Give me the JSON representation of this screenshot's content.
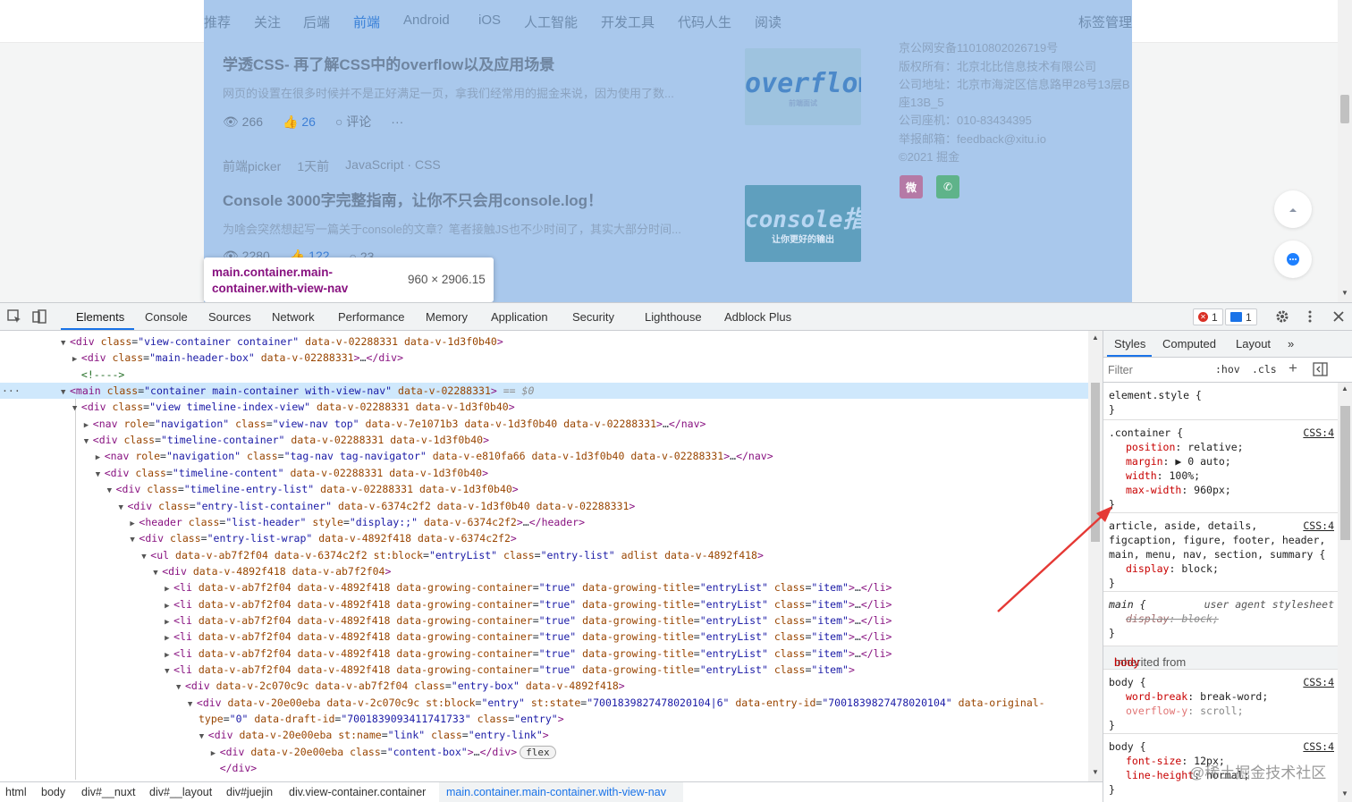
{
  "page": {
    "nav_items": [
      "推荐",
      "关注",
      "后端",
      "前端",
      "Android",
      "iOS",
      "人工智能",
      "开发工具",
      "代码人生",
      "阅读"
    ],
    "nav_active": "前端",
    "nav_right": "标签管理",
    "articles": [
      {
        "title": "学透CSS- 再了解CSS中的overflow以及应用场景",
        "desc": "网页的设置在很多时候并不是正好满足一页，拿我们经常用的掘金来说，因为使用了数...",
        "views": "266",
        "likes": "26",
        "comments": "评论",
        "more": "···",
        "thumb_big": "overflow",
        "thumb_small": "前端面试"
      },
      {
        "author": "前端picker",
        "time": "1天前",
        "tags": "JavaScript · CSS",
        "title": "Console 3000字完整指南，让你不只会用console.log！",
        "desc": "为啥会突然想起写一篇关于console的文章？笔者接触JS也不少时间了，其实大部分时间...",
        "views": "2280",
        "likes": "122",
        "comments": "23",
        "thumb_big": "console指南",
        "thumb_small": "让你更好的输出"
      }
    ],
    "footer": [
      "京公网安备11010802026719号",
      "版权所有：北京北比信息技术有限公司",
      "公司地址：北京市海淀区信息路甲28号13层B",
      "座13B_5",
      "公司座机：010-83434395",
      "举报邮箱：feedback@xitu.io",
      "©2021 掘金"
    ],
    "social": {
      "weibo": "微",
      "wechat": "✆"
    },
    "tooltip": {
      "selector": "main.container.main-container.with-view-nav",
      "size": "960 × 2906.15"
    }
  },
  "devtools": {
    "tabs": [
      "Elements",
      "Console",
      "Sources",
      "Network",
      "Performance",
      "Memory",
      "Application",
      "Security",
      "Lighthouse",
      "Adblock Plus"
    ],
    "active_tab": "Elements",
    "error_count": "1",
    "info_count": "1",
    "dom_lines": [
      {
        "indent": 0,
        "tri": "▼",
        "html": "<span class='tag'>&lt;div</span> <span class='an'>class</span>=<span class='av'>\"view-container container\"</span> <span class='an'>data-v-02288331</span> <span class='an'>data-v-1d3f0b40</span><span class='tag'>&gt;</span>"
      },
      {
        "indent": 1,
        "tri": "▶",
        "html": "<span class='tag'>&lt;div</span> <span class='an'>class</span>=<span class='av'>\"main-header-box\"</span> <span class='an'>data-v-02288331</span><span class='tag'>&gt;</span>…<span class='tag'>&lt;/div&gt;</span>"
      },
      {
        "indent": 1,
        "tri": "",
        "html": "<span class='cm'>&lt;!----&gt;</span>"
      },
      {
        "indent": 0,
        "tri": "▼",
        "selected": true,
        "html": "<span class='tag'>&lt;main</span> <span class='an'>class</span>=<span class='av'>\"container main-container with-view-nav\"</span> <span class='an'>data-v-02288331</span><span class='tag'>&gt;</span> <span class='eq'>== $0</span>"
      },
      {
        "indent": 1,
        "tri": "▼",
        "html": "<span class='tag'>&lt;div</span> <span class='an'>class</span>=<span class='av'>\"view timeline-index-view\"</span> <span class='an'>data-v-02288331</span> <span class='an'>data-v-1d3f0b40</span><span class='tag'>&gt;</span>"
      },
      {
        "indent": 2,
        "tri": "▶",
        "html": "<span class='tag'>&lt;nav</span> <span class='an'>role</span>=<span class='av'>\"navigation\"</span> <span class='an'>class</span>=<span class='av'>\"view-nav top\"</span> <span class='an'>data-v-7e1071b3</span> <span class='an'>data-v-1d3f0b40</span> <span class='an'>data-v-02288331</span><span class='tag'>&gt;</span>…<span class='tag'>&lt;/nav&gt;</span>"
      },
      {
        "indent": 2,
        "tri": "▼",
        "html": "<span class='tag'>&lt;div</span> <span class='an'>class</span>=<span class='av'>\"timeline-container\"</span> <span class='an'>data-v-02288331</span> <span class='an'>data-v-1d3f0b40</span><span class='tag'>&gt;</span>"
      },
      {
        "indent": 3,
        "tri": "▶",
        "html": "<span class='tag'>&lt;nav</span> <span class='an'>role</span>=<span class='av'>\"navigation\"</span> <span class='an'>class</span>=<span class='av'>\"tag-nav tag-navigator\"</span> <span class='an'>data-v-e810fa66</span> <span class='an'>data-v-1d3f0b40</span> <span class='an'>data-v-02288331</span><span class='tag'>&gt;</span>…<span class='tag'>&lt;/nav&gt;</span>"
      },
      {
        "indent": 3,
        "tri": "▼",
        "html": "<span class='tag'>&lt;div</span> <span class='an'>class</span>=<span class='av'>\"timeline-content\"</span> <span class='an'>data-v-02288331</span> <span class='an'>data-v-1d3f0b40</span><span class='tag'>&gt;</span>"
      },
      {
        "indent": 4,
        "tri": "▼",
        "html": "<span class='tag'>&lt;div</span> <span class='an'>class</span>=<span class='av'>\"timeline-entry-list\"</span> <span class='an'>data-v-02288331</span> <span class='an'>data-v-1d3f0b40</span><span class='tag'>&gt;</span>"
      },
      {
        "indent": 5,
        "tri": "▼",
        "html": "<span class='tag'>&lt;div</span> <span class='an'>class</span>=<span class='av'>\"entry-list-container\"</span> <span class='an'>data-v-6374c2f2</span> <span class='an'>data-v-1d3f0b40</span> <span class='an'>data-v-02288331</span><span class='tag'>&gt;</span>"
      },
      {
        "indent": 6,
        "tri": "▶",
        "html": "<span class='tag'>&lt;header</span> <span class='an'>class</span>=<span class='av'>\"list-header\"</span> <span class='an'>style</span>=<span class='av'>\"display:;\"</span> <span class='an'>data-v-6374c2f2</span><span class='tag'>&gt;</span>…<span class='tag'>&lt;/header&gt;</span>"
      },
      {
        "indent": 6,
        "tri": "▼",
        "html": "<span class='tag'>&lt;div</span> <span class='an'>class</span>=<span class='av'>\"entry-list-wrap\"</span> <span class='an'>data-v-4892f418</span> <span class='an'>data-v-6374c2f2</span><span class='tag'>&gt;</span>"
      },
      {
        "indent": 7,
        "tri": "▼",
        "html": "<span class='tag'>&lt;ul</span> <span class='an'>data-v-ab7f2f04</span> <span class='an'>data-v-6374c2f2</span> <span class='an'>st:block</span>=<span class='av'>\"entryList\"</span> <span class='an'>class</span>=<span class='av'>\"entry-list\"</span> <span class='an'>adlist</span> <span class='an'>data-v-4892f418</span><span class='tag'>&gt;</span>"
      },
      {
        "indent": 8,
        "tri": "▼",
        "html": "<span class='tag'>&lt;div</span> <span class='an'>data-v-4892f418</span> <span class='an'>data-v-ab7f2f04</span><span class='tag'>&gt;</span>"
      },
      {
        "indent": 9,
        "tri": "▶",
        "html": "<span class='tag'>&lt;li</span> <span class='an'>data-v-ab7f2f04</span> <span class='an'>data-v-4892f418</span> <span class='an'>data-growing-container</span>=<span class='av'>\"true\"</span> <span class='an'>data-growing-title</span>=<span class='av'>\"entryList\"</span> <span class='an'>class</span>=<span class='av'>\"item\"</span><span class='tag'>&gt;</span>…<span class='tag'>&lt;/li&gt;</span>"
      },
      {
        "indent": 9,
        "tri": "▶",
        "html": "<span class='tag'>&lt;li</span> <span class='an'>data-v-ab7f2f04</span> <span class='an'>data-v-4892f418</span> <span class='an'>data-growing-container</span>=<span class='av'>\"true\"</span> <span class='an'>data-growing-title</span>=<span class='av'>\"entryList\"</span> <span class='an'>class</span>=<span class='av'>\"item\"</span><span class='tag'>&gt;</span>…<span class='tag'>&lt;/li&gt;</span>"
      },
      {
        "indent": 9,
        "tri": "▶",
        "html": "<span class='tag'>&lt;li</span> <span class='an'>data-v-ab7f2f04</span> <span class='an'>data-v-4892f418</span> <span class='an'>data-growing-container</span>=<span class='av'>\"true\"</span> <span class='an'>data-growing-title</span>=<span class='av'>\"entryList\"</span> <span class='an'>class</span>=<span class='av'>\"item\"</span><span class='tag'>&gt;</span>…<span class='tag'>&lt;/li&gt;</span>"
      },
      {
        "indent": 9,
        "tri": "▶",
        "html": "<span class='tag'>&lt;li</span> <span class='an'>data-v-ab7f2f04</span> <span class='an'>data-v-4892f418</span> <span class='an'>data-growing-container</span>=<span class='av'>\"true\"</span> <span class='an'>data-growing-title</span>=<span class='av'>\"entryList\"</span> <span class='an'>class</span>=<span class='av'>\"item\"</span><span class='tag'>&gt;</span>…<span class='tag'>&lt;/li&gt;</span>"
      },
      {
        "indent": 9,
        "tri": "▶",
        "html": "<span class='tag'>&lt;li</span> <span class='an'>data-v-ab7f2f04</span> <span class='an'>data-v-4892f418</span> <span class='an'>data-growing-container</span>=<span class='av'>\"true\"</span> <span class='an'>data-growing-title</span>=<span class='av'>\"entryList\"</span> <span class='an'>class</span>=<span class='av'>\"item\"</span><span class='tag'>&gt;</span>…<span class='tag'>&lt;/li&gt;</span>"
      },
      {
        "indent": 9,
        "tri": "▼",
        "html": "<span class='tag'>&lt;li</span> <span class='an'>data-v-ab7f2f04</span> <span class='an'>data-v-4892f418</span> <span class='an'>data-growing-container</span>=<span class='av'>\"true\"</span> <span class='an'>data-growing-title</span>=<span class='av'>\"entryList\"</span> <span class='an'>class</span>=<span class='av'>\"item\"</span><span class='tag'>&gt;</span>"
      },
      {
        "indent": 10,
        "tri": "▼",
        "html": "<span class='tag'>&lt;div</span> <span class='an'>data-v-2c070c9c</span> <span class='an'>data-v-ab7f2f04</span> <span class='an'>class</span>=<span class='av'>\"entry-box\"</span> <span class='an'>data-v-4892f418</span><span class='tag'>&gt;</span>"
      },
      {
        "indent": 11,
        "tri": "▼",
        "html": "<span class='tag'>&lt;div</span> <span class='an'>data-v-20e00eba</span> <span class='an'>data-v-2c070c9c</span> <span class='an'>st:block</span>=<span class='av'>\"entry\"</span> <span class='an'>st:state</span>=<span class='av'>\"7001839827478020104|6\"</span> <span class='an'>data-entry-id</span>=<span class='av'>\"7001839827478020104\"</span> <span class='an'>data-original-</span>"
      },
      {
        "indent": 11,
        "tri": "",
        "wrap": true,
        "html": "<span class='an'>type</span>=<span class='av'>\"0\"</span> <span class='an'>data-draft-id</span>=<span class='av'>\"7001839093411741733\"</span> <span class='an'>class</span>=<span class='av'>\"entry\"</span><span class='tag'>&gt;</span>"
      },
      {
        "indent": 12,
        "tri": "▼",
        "html": "<span class='tag'>&lt;div</span> <span class='an'>data-v-20e00eba</span> <span class='an'>st:name</span>=<span class='av'>\"link\"</span> <span class='an'>class</span>=<span class='av'>\"entry-link\"</span><span class='tag'>&gt;</span>"
      },
      {
        "indent": 13,
        "tri": "▶",
        "html": "<span class='tag'>&lt;div</span> <span class='an'>data-v-20e00eba</span> <span class='an'>class</span>=<span class='av'>\"content-box\"</span><span class='tag'>&gt;</span>…<span class='tag'>&lt;/div&gt;</span><span class='flexbadge'>flex</span>"
      },
      {
        "indent": 13,
        "tri": "",
        "html": "<span class='tag'>&lt;/div&gt;</span>"
      }
    ],
    "breadcrumbs": [
      "html",
      "body",
      "div#__nuxt",
      "div#__layout",
      "div#juejin",
      "div.view-container.container",
      "main.container.main-container.with-view-nav"
    ],
    "styles_tabs": [
      "Styles",
      "Computed",
      "Layout",
      "»"
    ],
    "filter_placeholder": "Filter",
    "hov": ":hov",
    "cls": ".cls",
    "rules": {
      "element_style": "element.style {",
      "container_selector": ".container {",
      "container_src": "CSS:4",
      "container_props": [
        {
          "n": "position",
          "v": "relative;"
        },
        {
          "n": "margin",
          "v": "▶ 0 auto;"
        },
        {
          "n": "width",
          "v": "100%;"
        },
        {
          "n": "max-width",
          "v": "960px;"
        }
      ],
      "article_sel1": "article, aside, details,",
      "article_sel2": "figcaption, figure, footer, header,",
      "article_sel3": "main, menu, nav, section, summary {",
      "article_src": "CSS:4",
      "article_prop": {
        "n": "display",
        "v": "block;"
      },
      "main_sel": "main {",
      "main_src": "user agent stylesheet",
      "main_prop": {
        "n": "display",
        "v": "block;"
      },
      "inherited_label": "Inherited from",
      "inherited_tag": "body",
      "body1_sel": "body {",
      "body1_src": "CSS:4",
      "body1_props": [
        {
          "n": "word-break",
          "v": "break-word;"
        },
        {
          "n": "overflow-y",
          "v": "scroll;"
        }
      ],
      "body2_sel": "body {",
      "body2_src": "CSS:4",
      "body2_props": [
        {
          "n": "font-size",
          "v": "12px;"
        },
        {
          "n": "line-height",
          "v": "normal;"
        }
      ],
      "close": "}"
    }
  },
  "watermark": "@稀土掘金技术社区",
  "colors": {
    "highlight": "#a9c8ec",
    "accent": "#1a73e8",
    "arrow": "#e53935"
  }
}
